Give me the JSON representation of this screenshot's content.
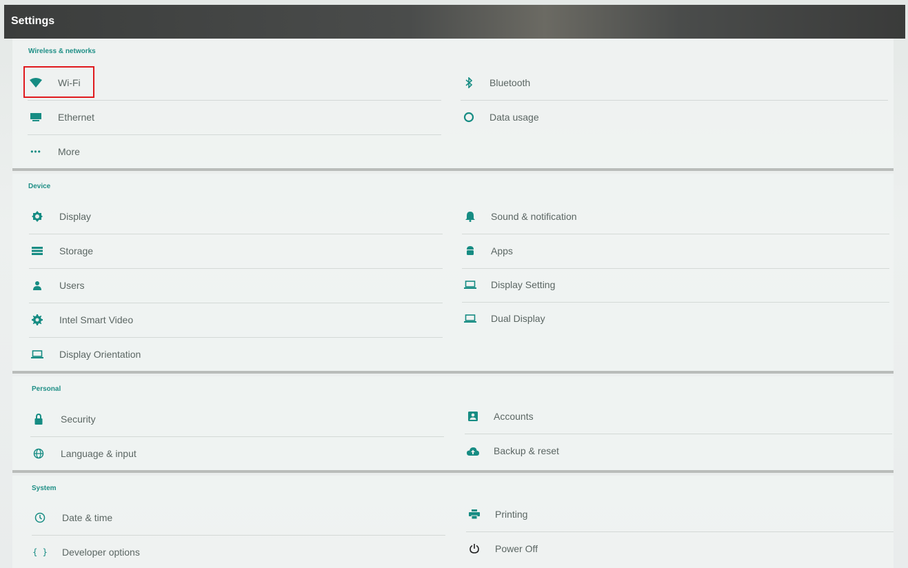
{
  "appbar": {
    "title": "Settings"
  },
  "accent_color": "#168c83",
  "sections": [
    {
      "header": "Wireless & networks",
      "left": [
        {
          "label": "Wi-Fi",
          "icon": "wifi-icon"
        },
        {
          "label": "Ethernet",
          "icon": "ethernet-icon"
        },
        {
          "label": "More",
          "icon": "more-icon"
        }
      ],
      "right": [
        {
          "label": "Bluetooth",
          "icon": "bluetooth-icon"
        },
        {
          "label": "Data usage",
          "icon": "data-usage-icon"
        }
      ]
    },
    {
      "header": "Device",
      "left": [
        {
          "label": "Display",
          "icon": "brightness-icon"
        },
        {
          "label": "Storage",
          "icon": "storage-icon"
        },
        {
          "label": "Users",
          "icon": "person-icon"
        },
        {
          "label": "Intel Smart Video",
          "icon": "gear-icon"
        },
        {
          "label": "Display Orientation",
          "icon": "laptop-icon"
        }
      ],
      "right": [
        {
          "label": "Sound & notification",
          "icon": "bell-icon"
        },
        {
          "label": "Apps",
          "icon": "android-icon"
        },
        {
          "label": "Display Setting",
          "icon": "laptop-icon"
        },
        {
          "label": "Dual Display",
          "icon": "laptop-icon"
        }
      ]
    },
    {
      "header": "Personal",
      "left": [
        {
          "label": "Security",
          "icon": "lock-icon"
        },
        {
          "label": "Language & input",
          "icon": "globe-icon"
        }
      ],
      "right": [
        {
          "label": "Accounts",
          "icon": "account-box-icon"
        },
        {
          "label": "Backup & reset",
          "icon": "cloud-upload-icon"
        }
      ]
    },
    {
      "header": "System",
      "left": [
        {
          "label": "Date & time",
          "icon": "clock-icon"
        },
        {
          "label": "Developer options",
          "icon": "braces-icon"
        }
      ],
      "right": [
        {
          "label": "Printing",
          "icon": "printer-icon"
        },
        {
          "label": "Power Off",
          "icon": "power-icon"
        }
      ]
    }
  ]
}
